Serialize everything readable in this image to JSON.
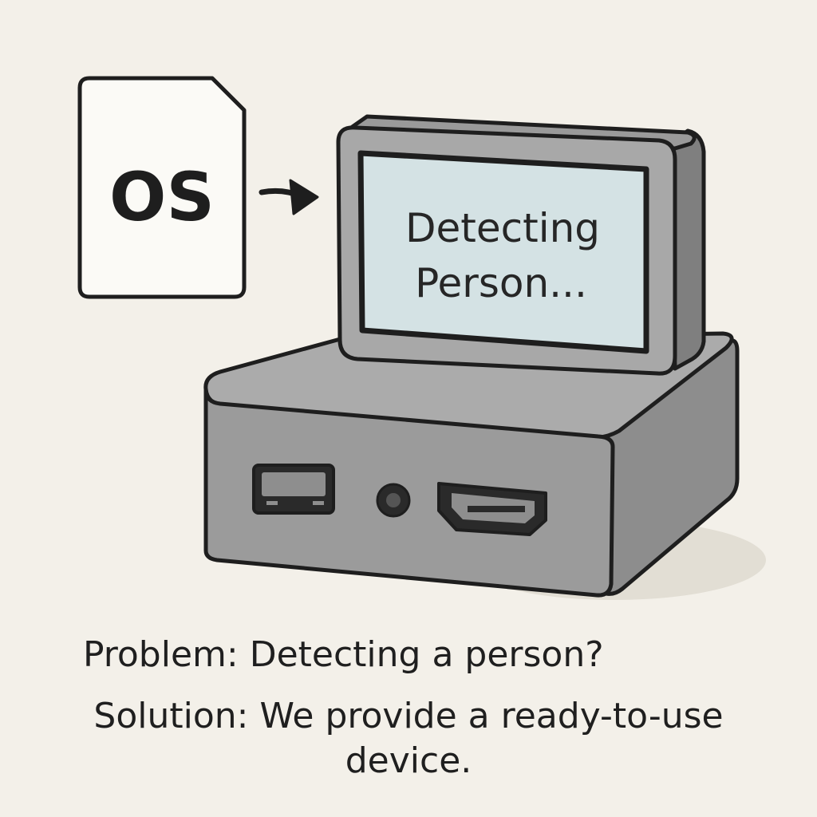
{
  "os_card": {
    "label": "OS"
  },
  "device": {
    "screen_line1": "Detecting",
    "screen_line2": "Person..."
  },
  "caption": {
    "problem": "Problem: Detecting a person?",
    "solution": "Solution: We provide a ready-to-use device."
  },
  "colors": {
    "background": "#f3f0e9",
    "device_body": "#9e9e9e",
    "screen": "#d4e2e4",
    "outline": "#1e1e1e"
  }
}
